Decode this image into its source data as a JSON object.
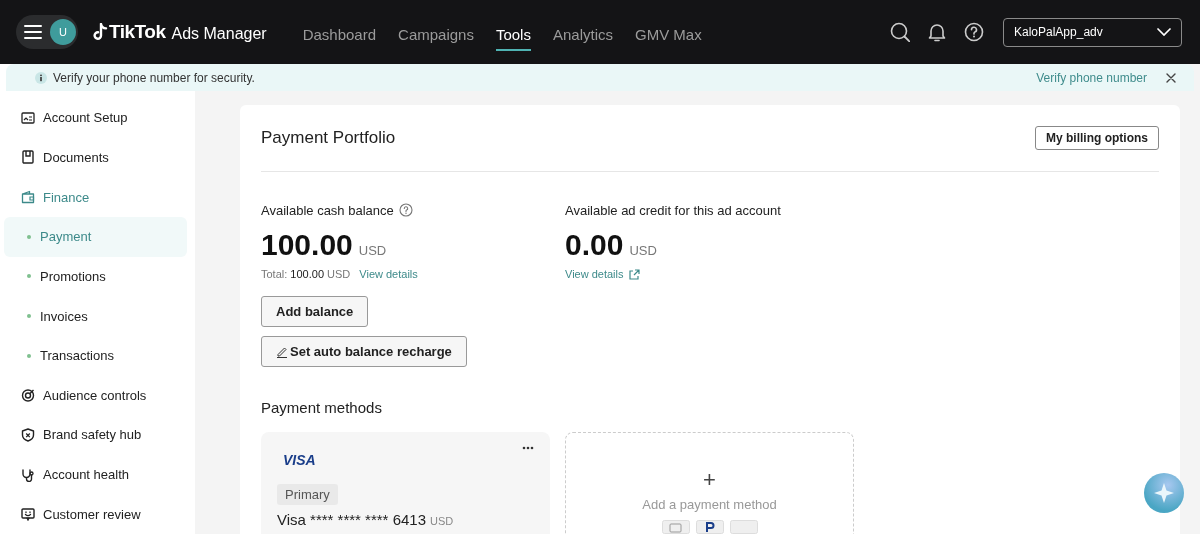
{
  "header": {
    "account_initial": "U",
    "logo": "TikTok",
    "product": "Ads Manager",
    "nav": [
      {
        "label": "Dashboard",
        "selected": false
      },
      {
        "label": "Campaigns",
        "selected": false
      },
      {
        "label": "Tools",
        "selected": true
      },
      {
        "label": "Analytics",
        "selected": false
      },
      {
        "label": "GMV Max",
        "selected": false
      }
    ],
    "account_selector": "KaloPalApp_adv"
  },
  "banner": {
    "message": "Verify your phone number for security.",
    "action": "Verify phone number"
  },
  "sidebar": {
    "items": [
      {
        "label": "Account Setup",
        "expanded": false
      },
      {
        "label": "Documents",
        "expanded": false
      },
      {
        "label": "Finance",
        "expanded": true,
        "children": [
          {
            "label": "Payment",
            "selected": true
          },
          {
            "label": "Promotions",
            "selected": false
          },
          {
            "label": "Invoices",
            "selected": false
          },
          {
            "label": "Transactions",
            "selected": false
          }
        ]
      },
      {
        "label": "Audience controls",
        "expanded": false
      },
      {
        "label": "Brand safety hub",
        "expanded": false
      },
      {
        "label": "Account health",
        "expanded": false
      },
      {
        "label": "Customer review",
        "expanded": false
      }
    ]
  },
  "portfolio": {
    "title": "Payment Portfolio",
    "billing_button": "My billing options",
    "cash": {
      "label": "Available cash balance",
      "amount": "100.00",
      "currency": "USD",
      "total": "Total: **100.00** USD",
      "link": "View details"
    },
    "credit": {
      "label": "Available ad credit for this ad account",
      "amount": "0.00",
      "currency": "USD",
      "link": "View details"
    },
    "buttons": [
      "Add balance",
      "Set auto balance recharge"
    ],
    "methods_title": "Payment methods",
    "methods": [
      {
        "kind": "card",
        "brand": "VISA",
        "badge": "Primary",
        "number": "Visa **** **** **** 6413",
        "currency": "USD"
      },
      {
        "kind": "add",
        "plus": "+",
        "label": "Add a payment method"
      }
    ]
  }
}
